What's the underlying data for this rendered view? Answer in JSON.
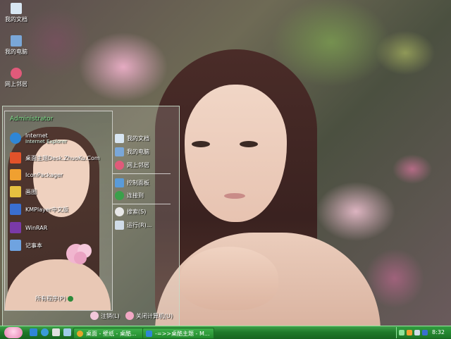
{
  "desktop_icons": [
    {
      "label": "我的文档",
      "icon": "my-documents-icon",
      "color": "#d8e6f2"
    },
    {
      "label": "我的电脑",
      "icon": "my-computer-icon",
      "color": "#7aa7d8"
    },
    {
      "label": "网上邻居",
      "icon": "network-places-icon",
      "color": "#e05a7a"
    }
  ],
  "start_menu": {
    "username": "Administrator",
    "pinned": [
      {
        "title": "Internet",
        "subtitle": "Internet Explorer",
        "icon": "internet-explorer-icon",
        "color": "#2f86d6"
      },
      {
        "title": "桌面主题Desk.ZhuoKu.Com",
        "icon": "theme-icon",
        "color": "#e2522a"
      }
    ],
    "programs": [
      {
        "title": "IconPackager",
        "icon": "iconpackager-icon",
        "color": "#f0a030"
      },
      {
        "title": "画图",
        "icon": "paint-icon",
        "color": "#e6c040"
      },
      {
        "title": "KMPlayer中文版",
        "icon": "kmplayer-icon",
        "color": "#3a6fd0"
      },
      {
        "title": "WinRAR",
        "icon": "winrar-icon",
        "color": "#7a3aa8"
      },
      {
        "title": "记事本",
        "icon": "notepad-icon",
        "color": "#6fa3e0"
      }
    ],
    "all_programs": "所有程序(P)",
    "places": [
      {
        "title": "我的文档",
        "icon": "my-documents-icon",
        "color": "#d8e6f2"
      },
      {
        "title": "我的电脑",
        "icon": "my-computer-icon",
        "color": "#7aa7d8"
      },
      {
        "title": "网上邻居",
        "icon": "network-places-icon",
        "color": "#e05a7a"
      },
      {
        "title": "控制面板",
        "icon": "control-panel-icon",
        "color": "#5a9bd8"
      },
      {
        "title": "连接到",
        "icon": "connect-to-icon",
        "color": "#3aa04a"
      },
      {
        "title": "搜索(S)",
        "icon": "search-icon",
        "color": "#e8e8e8"
      },
      {
        "title": "运行(R)...",
        "icon": "run-icon",
        "color": "#d0dce8"
      }
    ],
    "logoff": "注销(L)",
    "shutdown": "关闭计算机(U)"
  },
  "taskbar": {
    "tasks": [
      {
        "label": "桌面 - 壁纸 - 桌酷...",
        "icon": "browser-icon",
        "color": "#e5a52a"
      },
      {
        "label": "-=>>桌酷主题 - M...",
        "icon": "window-icon",
        "color": "#2f86d6"
      }
    ],
    "clock": "8:32"
  },
  "colors": {
    "taskbar": "#1f7a2a",
    "username": "#7fe08a"
  }
}
